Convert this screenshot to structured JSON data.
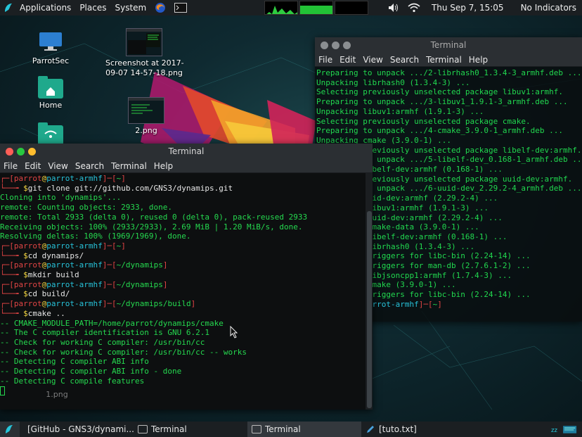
{
  "top_panel": {
    "applications": "Applications",
    "places": "Places",
    "system": "System",
    "clock": "Thu Sep  7, 15:05",
    "indicators": "No Indicators",
    "icons": [
      "parrot-logo-icon",
      "firefox-icon",
      "terminal-icon",
      "volume-icon",
      "wifi-icon"
    ]
  },
  "desktop": {
    "icons": [
      {
        "label": "ParrotSec",
        "icon": "computer-icon"
      },
      {
        "label": "Home",
        "icon": "home-folder-icon"
      },
      {
        "label": "",
        "icon": "network-folder-icon"
      },
      {
        "label": "Screenshot at 2017-\n09-07 14-57-18.png",
        "icon": "image-thumbnail-icon"
      },
      {
        "label": "2.png",
        "icon": "image-thumbnail-icon"
      },
      {
        "label": "1.png",
        "icon": "image-thumbnail-icon"
      }
    ]
  },
  "terminal_back": {
    "title": "Terminal",
    "menu": [
      "File",
      "Edit",
      "View",
      "Search",
      "Terminal",
      "Help"
    ],
    "lines": [
      "Preparing to unpack .../2-librhash0_1.3.4-3_armhf.deb ...",
      "Unpacking librhash0 (1.3.4-3) ...",
      "Selecting previously unselected package libuv1:armhf.",
      "Preparing to unpack .../3-libuv1_1.9.1-3_armhf.deb ...",
      "Unpacking libuv1:armhf (1.9.1-3) ...",
      "Selecting previously unselected package cmake.",
      "Preparing to unpack .../4-cmake_3.9.0-1_armhf.deb ...",
      "Unpacking cmake (3.9.0-1) ...",
      "Selecting previously unselected package libelf-dev:armhf.",
      "Preparing to unpack .../5-libelf-dev_0.168-1_armhf.deb ...",
      "Unpacking libelf-dev:armhf (0.168-1) ...",
      "Selecting previously unselected package uuid-dev:armhf.",
      "Preparing to unpack .../6-uuid-dev_2.29.2-4_armhf.deb ...",
      "Unpacking uuid-dev:armhf (2.29.2-4) ...",
      "Setting up libuv1:armhf (1.9.1-3) ...",
      "Setting up uuid-dev:armhf (2.29.2-4) ...",
      "Setting up cmake-data (3.9.0-1) ...",
      "Setting up libelf-dev:armhf (0.168-1) ...",
      "Setting up librhash0 (1.3.4-3) ...",
      "Processing triggers for libc-bin (2.24-14) ...",
      "Processing triggers for man-db (2.7.6.1-2) ...",
      "Setting up libjsoncpp1:armhf (1.7.4-3) ...",
      "Setting up cmake (3.9.0-1) ...",
      "Processing triggers for libc-bin (2.24-14) ..."
    ],
    "prompt_user": "parrot",
    "prompt_host": "parrot-armhf",
    "prompt_dir": "~"
  },
  "terminal_front": {
    "title": "Terminal",
    "menu": [
      "File",
      "Edit",
      "View",
      "Search",
      "Terminal",
      "Help"
    ],
    "prompt_user": "parrot",
    "prompt_at": "@",
    "prompt_host": "parrot-armhf",
    "blocks": [
      {
        "dir": "~",
        "cmd": "git clone git://github.com/GNS3/dynamips.git",
        "output": [
          "Cloning into 'dynamips'...",
          "remote: Counting objects: 2933, done.",
          "remote: Total 2933 (delta 0), reused 0 (delta 0), pack-reused 2933",
          "Receiving objects: 100% (2933/2933), 2.69 MiB | 1.20 MiB/s, done.",
          "Resolving deltas: 100% (1969/1969), done."
        ]
      },
      {
        "dir": "~",
        "cmd": "cd dynamips/",
        "output": []
      },
      {
        "dir": "~/dynamips",
        "cmd": "mkdir build",
        "output": []
      },
      {
        "dir": "~/dynamips",
        "cmd": "cd build/",
        "output": []
      },
      {
        "dir": "~/dynamips/build",
        "cmd": "cmake ..",
        "output": [
          "-- CMAKE_MODULE_PATH=/home/parrot/dynamips/cmake",
          "-- The C compiler identification is GNU 6.2.1",
          "-- Check for working C compiler: /usr/bin/cc",
          "-- Check for working C compiler: /usr/bin/cc -- works",
          "-- Detecting C compiler ABI info",
          "-- Detecting C compiler ABI info - done",
          "-- Detecting C compile features"
        ]
      }
    ]
  },
  "taskbar": {
    "items": [
      {
        "label": "[GitHub - GNS3/dynami...",
        "icon": "firefox-icon",
        "active": false
      },
      {
        "label": "Terminal",
        "icon": "terminal-icon",
        "active": false
      },
      {
        "label": "Terminal",
        "icon": "terminal-icon",
        "active": true
      },
      {
        "label": "[tuto.txt]",
        "icon": "text-editor-icon",
        "active": false
      }
    ]
  },
  "colors": {
    "prompt_bracket": "#e04444",
    "prompt_host": "#27c2d9",
    "prompt_symbol": "#f5d742",
    "output_green": "#25d94f"
  }
}
